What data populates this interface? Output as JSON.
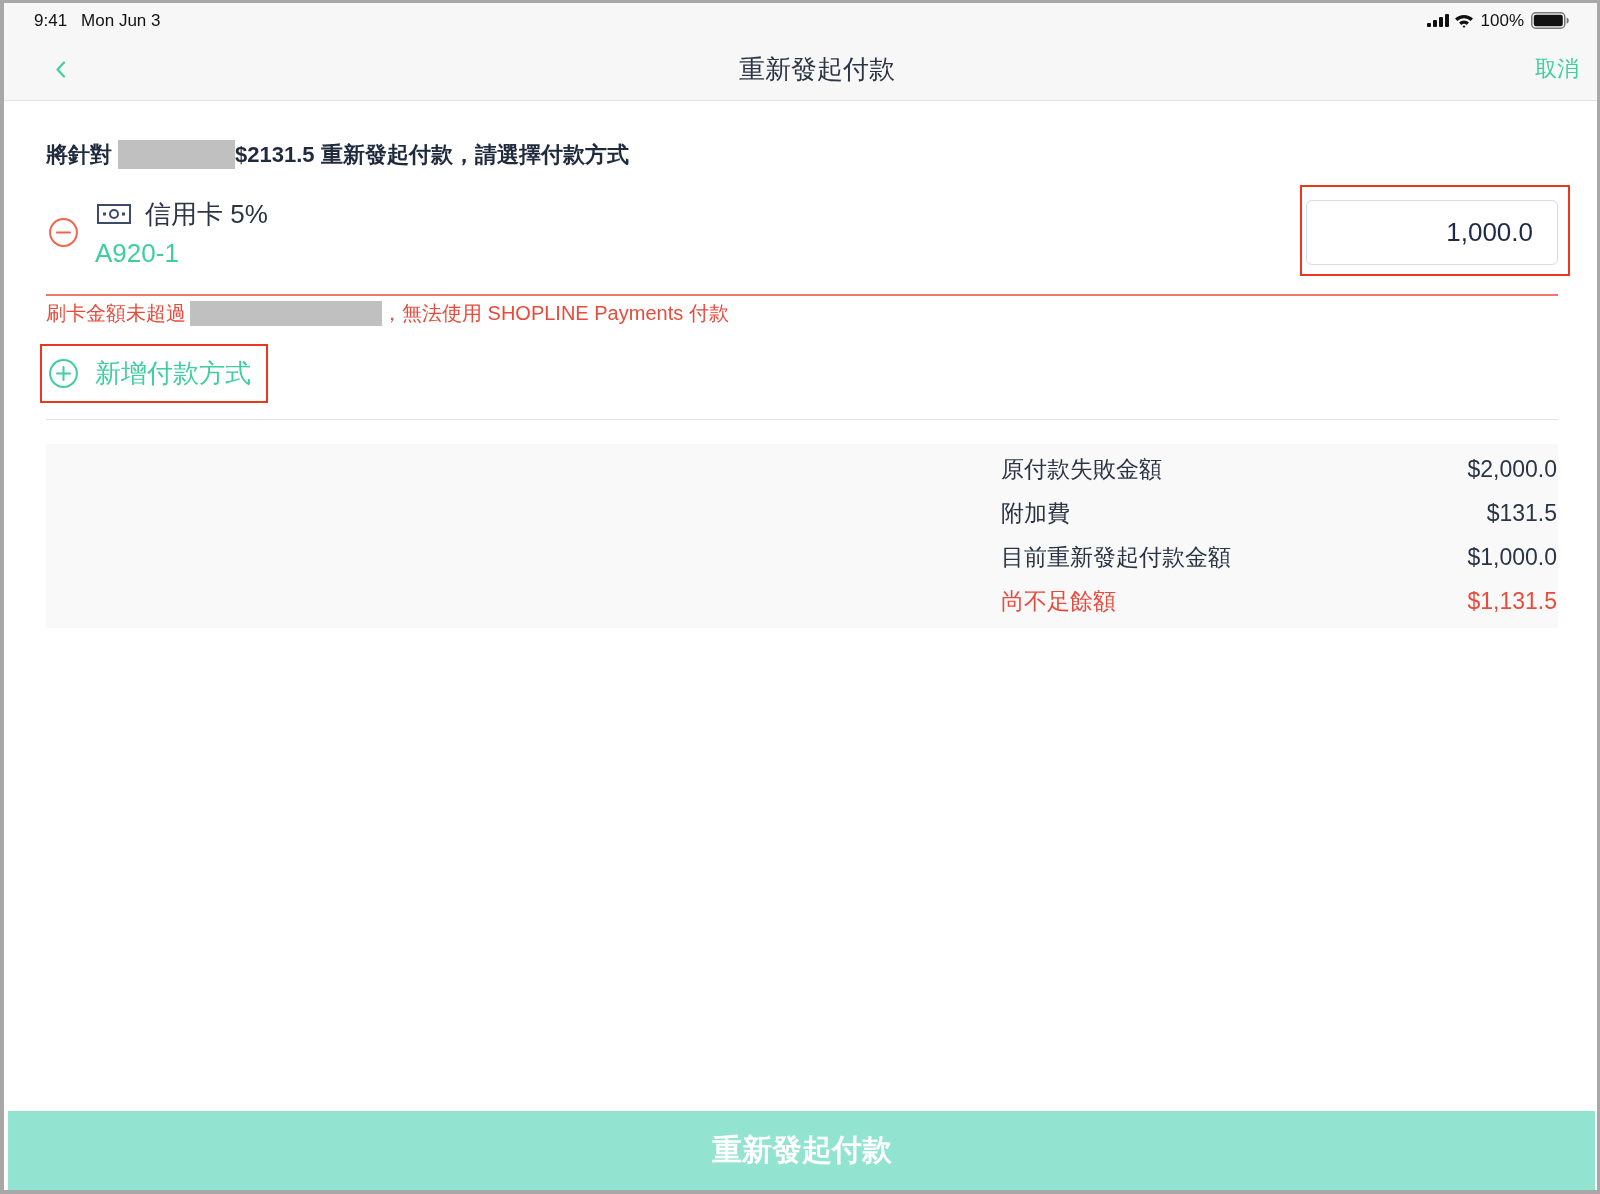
{
  "status_bar": {
    "time": "9:41",
    "date": "Mon Jun 3",
    "battery": "100%"
  },
  "nav_bar": {
    "title": "重新發起付款",
    "cancel": "取消"
  },
  "intro": [
    {
      "kind": "text",
      "text": "將針對"
    },
    {
      "kind": "redacted"
    },
    {
      "kind": "text",
      "text": "$2131.5 重新發起付款，請選擇付款方式"
    }
  ],
  "payments": [
    {
      "method": "信用卡 5%",
      "terminal": "A920-1",
      "amount": "1,000.0",
      "highlighted": true,
      "invalid": true,
      "error": [
        {
          "kind": "text",
          "text": "刷卡金額未超過"
        },
        {
          "kind": "redacted"
        },
        {
          "kind": "text",
          "text": "，無法使用 SHOPLINE Payments 付款"
        }
      ]
    }
  ],
  "add_button": {
    "label": "新增付款方式",
    "highlighted": true
  },
  "summary": [
    {
      "label": "原付款失敗金額",
      "value": "$2,000.0",
      "kind": "normal"
    },
    {
      "label": "附加費",
      "value": "$131.5",
      "kind": "normal"
    },
    {
      "label": "目前重新發起付款金額",
      "value": "$1,000.0",
      "kind": "normal"
    },
    {
      "label": "尚不足餘額",
      "value": "$1,131.5",
      "kind": "alert"
    }
  ],
  "submit_button": {
    "label": "重新發起付款",
    "disabled": true
  }
}
